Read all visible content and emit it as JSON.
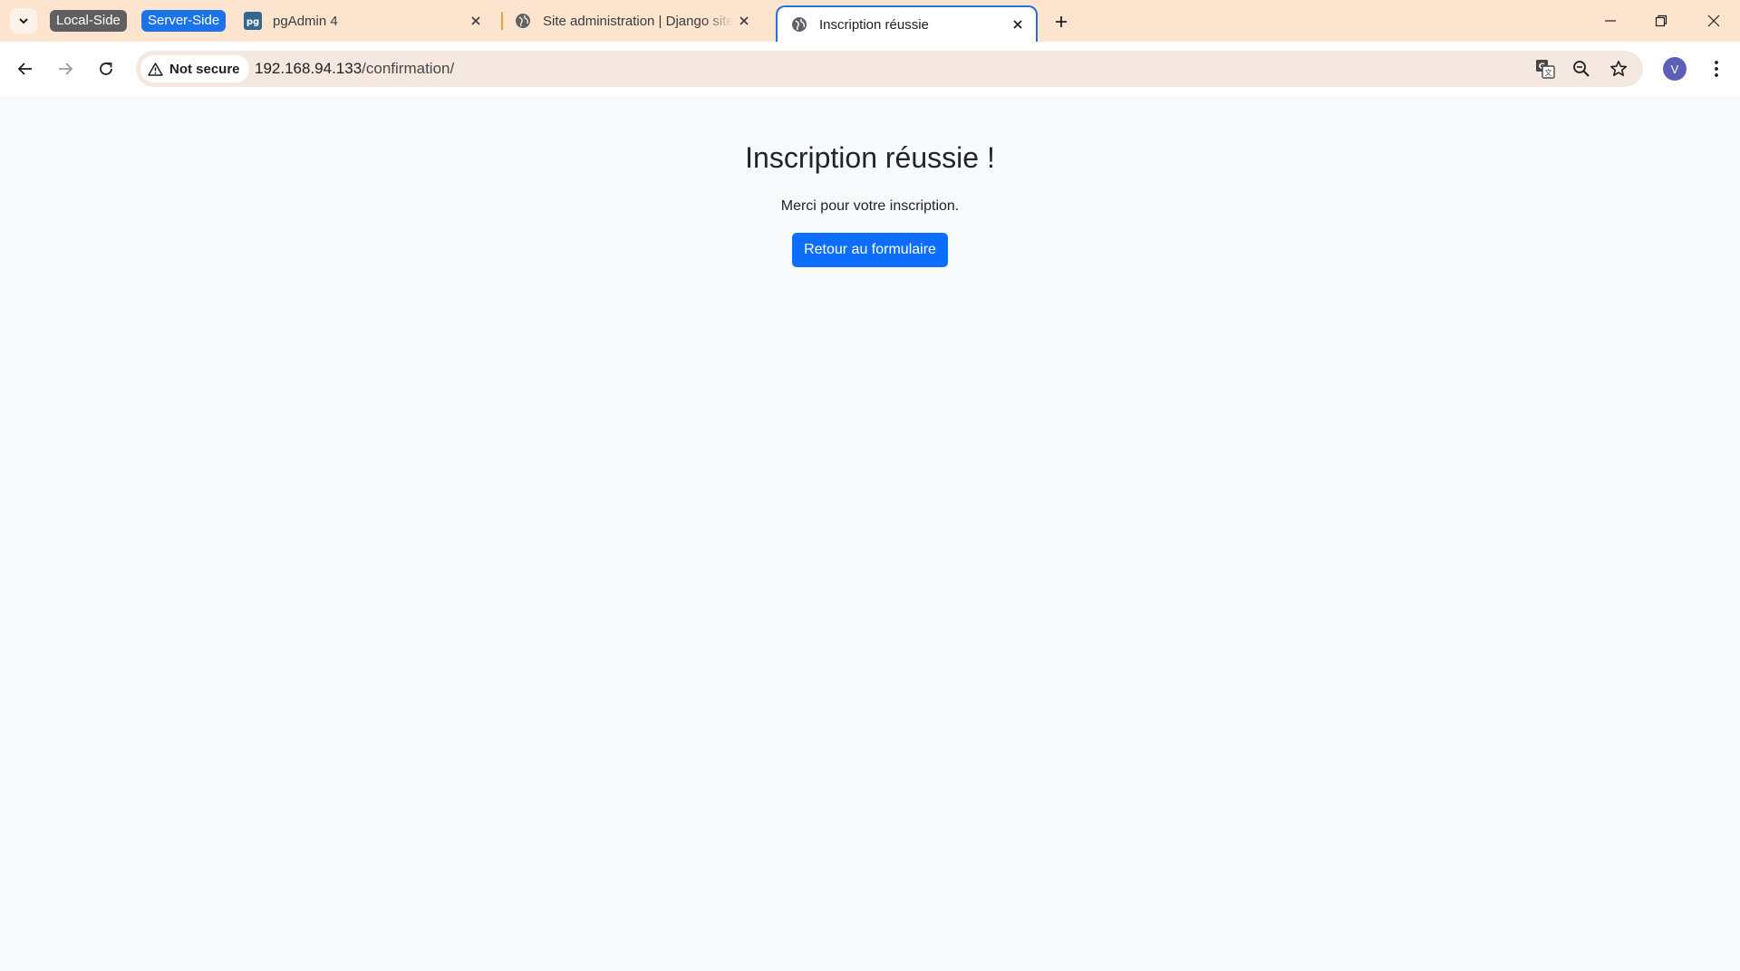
{
  "browser": {
    "tab_groups": [
      {
        "label": "Local-Side",
        "color": "#5f5f5f"
      },
      {
        "label": "Server-Side",
        "color": "#1a73e8"
      }
    ],
    "tabs": [
      {
        "title": "pgAdmin 4",
        "favicon": "pgadmin-icon",
        "active": false
      },
      {
        "title": "Site administration | Django site admin",
        "favicon": "globe-icon",
        "active": false
      },
      {
        "title": "Inscription réussie",
        "favicon": "globe-icon",
        "active": true
      }
    ],
    "accent_color": "#f1a33b",
    "address_bar": {
      "security_label": "Not secure",
      "host": "192.168.94.133",
      "path": "/confirmation/"
    },
    "profile_initial": "V"
  },
  "page": {
    "title": "Inscription réussie !",
    "message": "Merci pour votre inscription.",
    "button_label": "Retour au formulaire",
    "button_color": "#0d6efd"
  }
}
